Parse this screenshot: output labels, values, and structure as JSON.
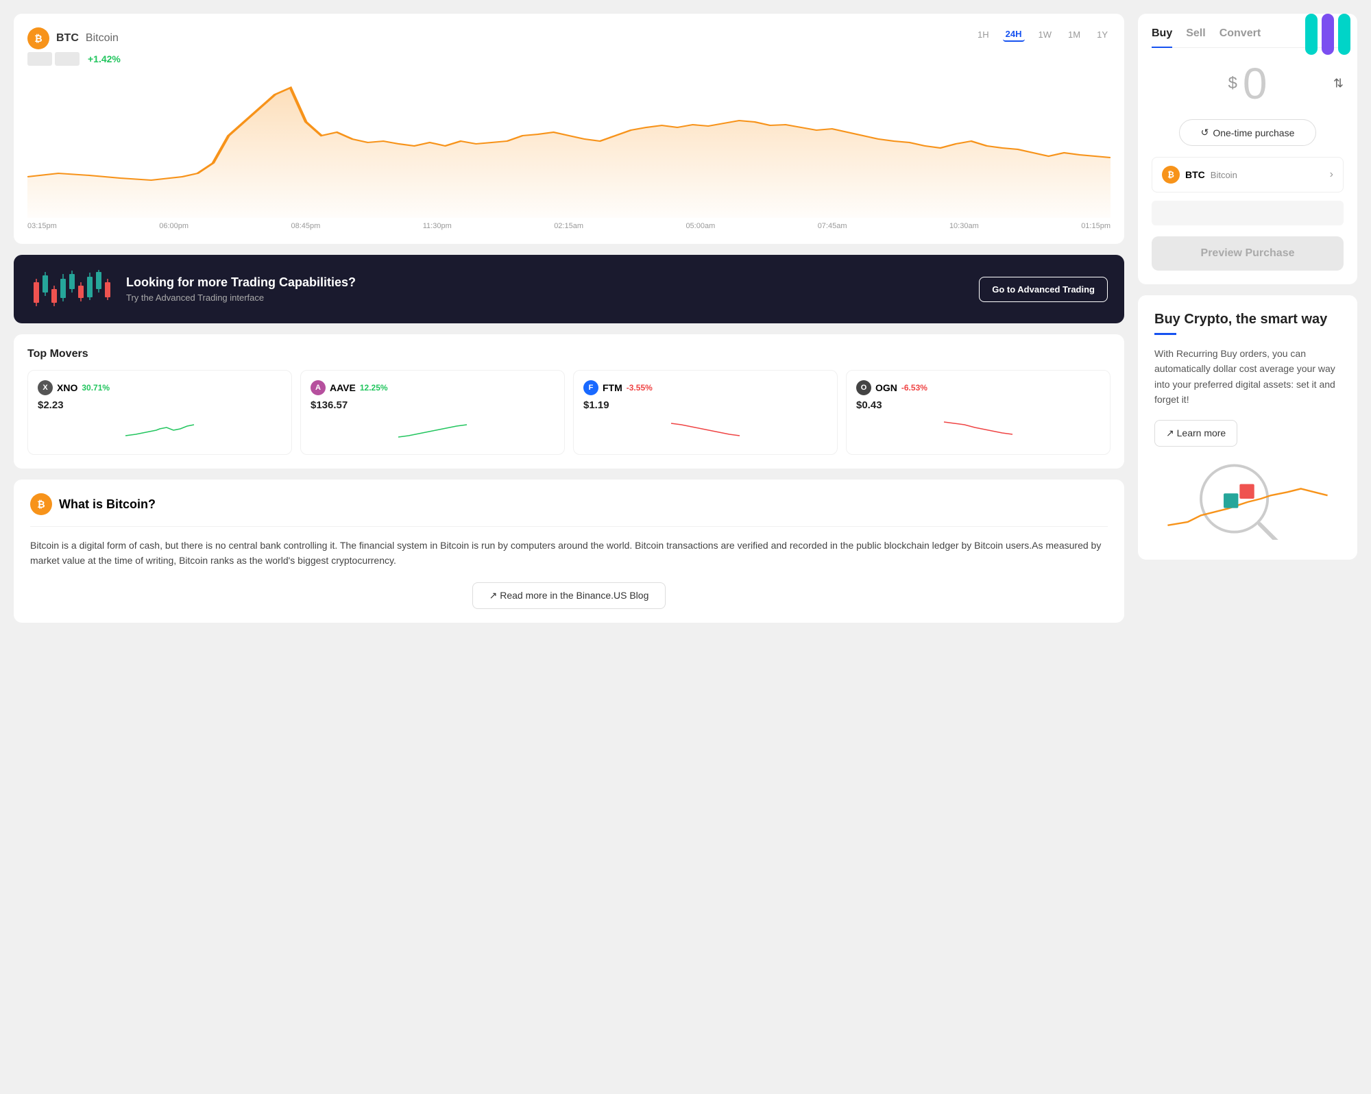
{
  "header": {
    "logo_bars": [
      "#00d4c8",
      "#7b4ef0",
      "#00d4c8"
    ]
  },
  "chart": {
    "coin_ticker": "BTC",
    "coin_name": "Bitcoin",
    "coin_icon_letter": "₿",
    "price_change": "+1.42%",
    "time_options": [
      "1H",
      "24H",
      "1W",
      "1M",
      "1Y"
    ],
    "active_time": "24H",
    "time_labels": [
      "03:15pm",
      "06:00pm",
      "08:45pm",
      "11:30pm",
      "02:15am",
      "05:00am",
      "07:45am",
      "10:30am",
      "01:15pm"
    ]
  },
  "banner": {
    "title": "Looking for more Trading Capabilities?",
    "subtitle": "Try the Advanced Trading interface",
    "button_label": "Go to Advanced Trading"
  },
  "top_movers": {
    "section_title": "Top Movers",
    "items": [
      {
        "ticker": "XNO",
        "pct": "30.71%",
        "pct_positive": true,
        "price": "$2.23",
        "icon_color": "#555",
        "icon_letter": "X"
      },
      {
        "ticker": "AAVE",
        "pct": "12.25%",
        "pct_positive": true,
        "price": "$136.57",
        "icon_color": "#b6509e",
        "icon_letter": "A"
      },
      {
        "ticker": "FTM",
        "pct": "-3.55%",
        "pct_positive": false,
        "price": "$1.19",
        "icon_color": "#1969ff",
        "icon_letter": "F"
      },
      {
        "ticker": "OGN",
        "pct": "-6.53%",
        "pct_positive": false,
        "price": "$0.43",
        "icon_color": "#222",
        "icon_letter": "O"
      }
    ]
  },
  "bitcoin_info": {
    "title": "What is Bitcoin?",
    "text": "Bitcoin is a digital form of cash, but there is no central bank controlling it. The financial system in Bitcoin is run by computers around the world. Bitcoin transactions are verified and recorded in the public blockchain ledger by Bitcoin users.As measured by market value at the time of writing, Bitcoin ranks as the world's biggest cryptocurrency.",
    "read_more_label": "↗ Read more in the Binance.US Blog"
  },
  "trade_panel": {
    "tabs": [
      "Buy",
      "Sell",
      "Convert"
    ],
    "active_tab": "Buy",
    "amount_symbol": "$",
    "amount_value": "0",
    "purchase_type_label": "One-time purchase",
    "asset_ticker": "BTC",
    "asset_name": "Bitcoin",
    "preview_button_label": "Preview Purchase"
  },
  "smart_buy": {
    "title": "Buy Crypto, the smart way",
    "text": "With Recurring Buy orders, you can automatically dollar cost average your way into your preferred digital assets: set it and forget it!",
    "learn_more_label": "↗ Learn more"
  }
}
